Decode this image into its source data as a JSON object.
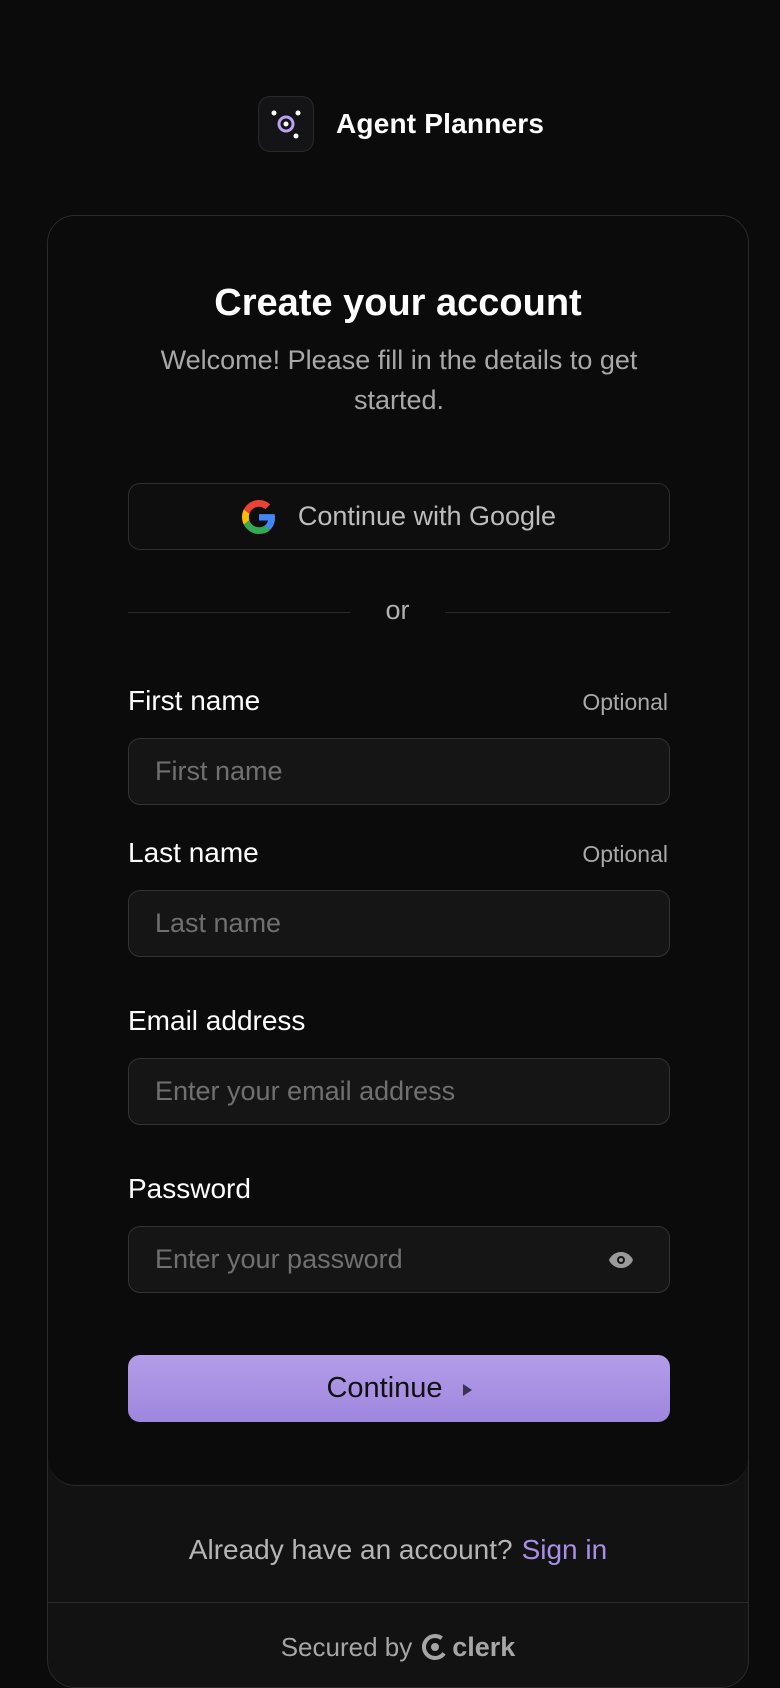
{
  "brand": {
    "name": "Agent Planners",
    "logo_icon": "orbit-logo-icon",
    "accent": "#a98ee8"
  },
  "card": {
    "title": "Create your account",
    "subtitle": "Welcome! Please fill in the details to get started."
  },
  "social": {
    "google_label": "Continue with Google",
    "google_icon": "google-icon"
  },
  "divider_text": "or",
  "form": {
    "first_name": {
      "label": "First name",
      "optional": "Optional",
      "placeholder": "First name",
      "value": ""
    },
    "last_name": {
      "label": "Last name",
      "optional": "Optional",
      "placeholder": "Last name",
      "value": ""
    },
    "email": {
      "label": "Email address",
      "placeholder": "Enter your email address",
      "value": ""
    },
    "password": {
      "label": "Password",
      "placeholder": "Enter your password",
      "value": "",
      "toggle_icon": "eye-icon"
    },
    "submit_label": "Continue"
  },
  "footer": {
    "signin_prompt": "Already have an account?",
    "signin_link": "Sign in",
    "secured_by": "Secured by",
    "provider": "clerk"
  },
  "colors": {
    "background": "#0b0b0b",
    "button": "#a98ee8",
    "link": "#a98ee8"
  }
}
